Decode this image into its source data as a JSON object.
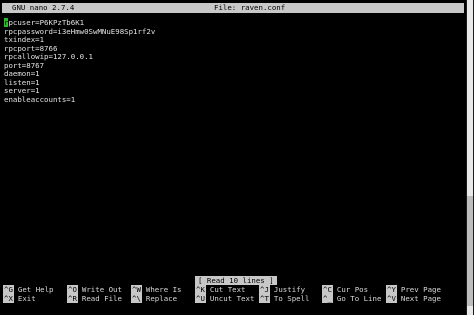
{
  "header": {
    "version": "GNU nano 2.7.4",
    "file_label": "File: raven.conf"
  },
  "editor": {
    "cursor_char": "r",
    "first_line_rest": "pcuser=P6KPzTb6K1",
    "lines": [
      "rpcpassword=i3eHmw0SwMNuE98Sp1rf2v",
      "txindex=1",
      "rpcport=8766",
      "rpcallowip=127.0.0.1",
      "port=8767",
      "daemon=1",
      "listen=1",
      "server=1",
      "enableaccounts=1"
    ]
  },
  "status": "[ Read 10 lines ]",
  "shortcuts": [
    {
      "key": "^G",
      "label": "Get Help"
    },
    {
      "key": "^X",
      "label": "Exit"
    },
    {
      "key": "^O",
      "label": "Write Out"
    },
    {
      "key": "^R",
      "label": "Read File"
    },
    {
      "key": "^W",
      "label": "Where Is"
    },
    {
      "key": "^\\",
      "label": "Replace"
    },
    {
      "key": "^K",
      "label": "Cut Text"
    },
    {
      "key": "^U",
      "label": "Uncut Text"
    },
    {
      "key": "^J",
      "label": "Justify"
    },
    {
      "key": "^T",
      "label": "To Spell"
    },
    {
      "key": "^C",
      "label": "Cur Pos"
    },
    {
      "key": "^_",
      "label": "Go To Line"
    },
    {
      "key": "^Y",
      "label": "Prev Page"
    },
    {
      "key": "^V",
      "label": "Next Page"
    }
  ]
}
